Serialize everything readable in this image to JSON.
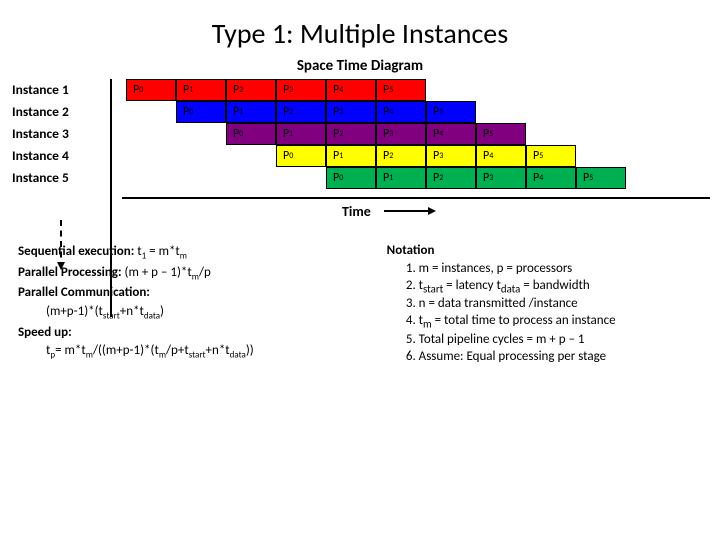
{
  "title": "Type 1: Multiple Instances",
  "subtitle": "Space Time Diagram",
  "time_label": "Time",
  "chart_data": {
    "type": "table",
    "xlabel": "Time",
    "ylabel": "Instance",
    "instances": [
      {
        "label": "Instance 1",
        "offset": 0,
        "color": "red",
        "cells": [
          "P 0",
          "P 1",
          "P 2",
          "P 3",
          "P 4",
          "P 5"
        ]
      },
      {
        "label": "Instance 2",
        "offset": 1,
        "color": "blue",
        "cells": [
          "P 0",
          "P 1",
          "P 2",
          "P 3",
          "P 4",
          "P 5"
        ]
      },
      {
        "label": "Instance 3",
        "offset": 2,
        "color": "purple",
        "cells": [
          "P 0",
          "P 1",
          "P 2",
          "P 3",
          "P 4",
          "P 5"
        ]
      },
      {
        "label": "Instance 4",
        "offset": 3,
        "color": "yellow",
        "cells": [
          "P 0",
          "P 1",
          "P 2",
          "P 3",
          "P 4",
          "P 5"
        ]
      },
      {
        "label": "Instance 5",
        "offset": 4,
        "color": "green",
        "cells": [
          "P 0",
          "P 1",
          "P 2",
          "P 3",
          "P 4",
          "P 5"
        ]
      }
    ],
    "processors_per_instance": 6,
    "num_instances": 5
  },
  "formulas": {
    "seq_label": "Sequential execution:",
    "seq_rhs": "= m*t",
    "seq_lhs_var": "t",
    "parproc_label": "Parallel Processing:",
    "parproc_body": "(m + p – 1)*t",
    "parproc_tail": "/p",
    "parcomm_label": "Parallel Communication:",
    "parcomm_body_a": "(m+p-1)*(t",
    "parcomm_body_b": "+n*t",
    "parcomm_body_c": ")",
    "speedup_label": "Speed up:",
    "speedup_a": "t",
    "speedup_b": "= m*t",
    "speedup_c": "/((m+p-1)*(t",
    "speedup_d": "/p+t",
    "speedup_e": "+n*t",
    "speedup_f": "))",
    "sub_1": "1",
    "sub_m": "m",
    "sub_p": "p",
    "sub_start": "start",
    "sub_data": "data"
  },
  "notation": {
    "header": "Notation",
    "items": [
      "m = instances, p = processors",
      "t<sub>start</sub> = latency t<sub>data</sub> = bandwidth",
      "n = data transmitted /instance",
      "t<sub>m</sub> = total time to process an instance",
      "Total pipeline cycles = m + p – 1",
      "Assume: Equal processing per stage"
    ]
  }
}
